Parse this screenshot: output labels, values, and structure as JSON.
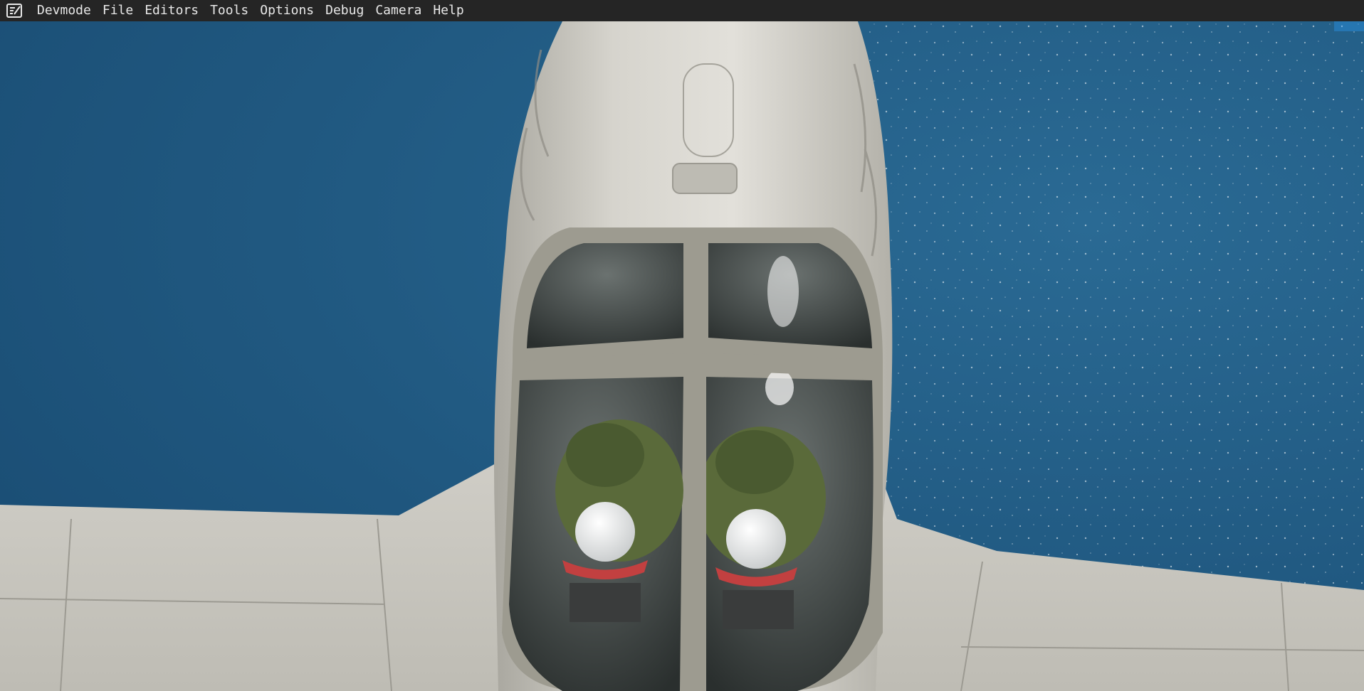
{
  "app": {
    "logo_icon": "devmode-logo-icon"
  },
  "menubar": {
    "items": [
      {
        "label": "Devmode"
      },
      {
        "label": "File"
      },
      {
        "label": "Editors"
      },
      {
        "label": "Tools"
      },
      {
        "label": "Options"
      },
      {
        "label": "Debug"
      },
      {
        "label": "Camera"
      },
      {
        "label": "Help"
      }
    ]
  },
  "colors": {
    "menubar_bg": "#252525",
    "menu_text": "#e8e8e8",
    "ocean": "#1f5a82",
    "airframe": "#c9c7c0",
    "canopy_frame": "#9d9b90"
  }
}
